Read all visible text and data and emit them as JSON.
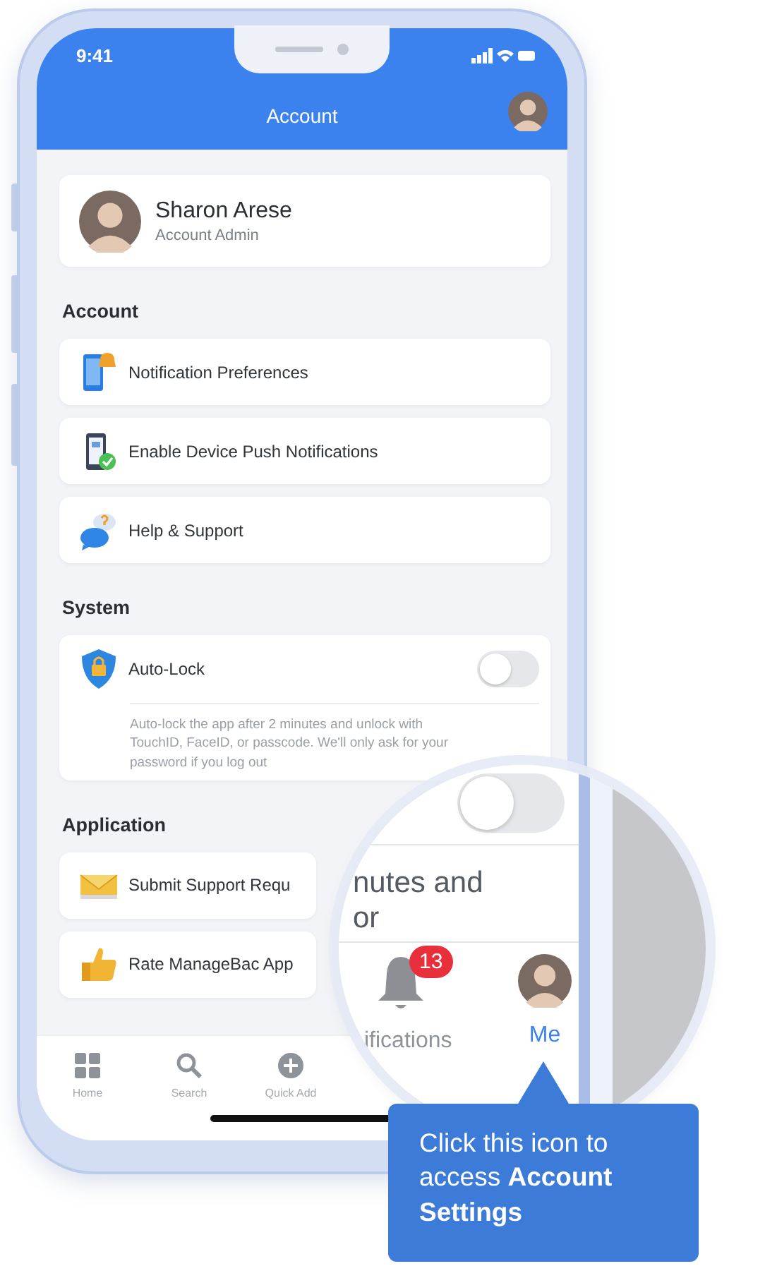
{
  "status_bar": {
    "time": "9:41"
  },
  "header": {
    "title": "Account"
  },
  "profile": {
    "name": "Sharon Arese",
    "role": "Account Admin"
  },
  "sections": [
    {
      "title": "Account",
      "items": [
        {
          "kind": "link",
          "label": "Notification Preferences"
        },
        {
          "kind": "link",
          "label": "Enable Device Push Notifications"
        },
        {
          "kind": "link",
          "label": "Help & Support"
        }
      ]
    },
    {
      "title": "System",
      "items": [
        {
          "kind": "toggle",
          "label": "Auto-Lock",
          "on": false,
          "description": "Auto-lock the app after 2 minutes and unlock with TouchID, FaceID, or passcode. We'll only ask for your password if you log out"
        }
      ]
    },
    {
      "title": "Application",
      "items": [
        {
          "kind": "link",
          "label": "Submit Support Requ"
        },
        {
          "kind": "link",
          "label": "Rate ManageBac App"
        }
      ]
    }
  ],
  "tab_bar": [
    {
      "label": "Home",
      "selected": false
    },
    {
      "label": "Search",
      "selected": false
    },
    {
      "label": "Quick Add",
      "selected": false
    }
  ],
  "magnifier": {
    "lines": [
      "nutes and",
      "or"
    ],
    "tabs": [
      {
        "label": "ifications",
        "badge": "13",
        "selected": false
      },
      {
        "label": "Me",
        "selected": true
      }
    ]
  },
  "tooltip": {
    "text": "Click this icon to access **Account Settings**"
  }
}
